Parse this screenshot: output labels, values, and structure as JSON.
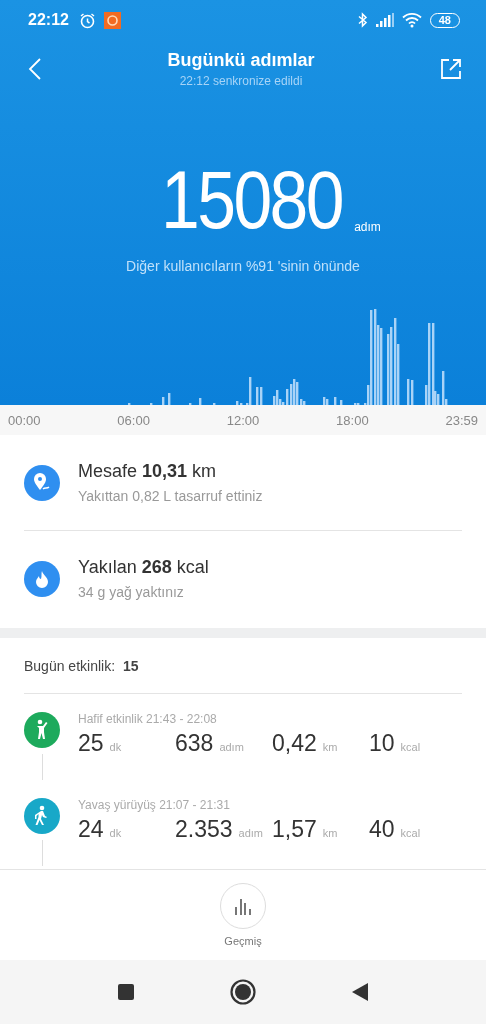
{
  "status_bar": {
    "time": "22:12",
    "battery": "48"
  },
  "header": {
    "title": "Bugünkü adımlar",
    "subtitle": "22:12 senkronize edildi"
  },
  "steps": {
    "value": "15080",
    "unit": "adım",
    "rank": "Diğer kullanıcıların %91 'sinin önünde"
  },
  "timeline": [
    "00:00",
    "06:00",
    "12:00",
    "18:00",
    "23:59"
  ],
  "metrics": [
    {
      "kind": "distance",
      "title": "Mesafe **10,31** km",
      "note": "Yakıttan 0,82 L tasarruf ettiniz"
    },
    {
      "kind": "calories",
      "title": "Yakılan **268** kcal",
      "note": "34 g yağ yaktınız"
    }
  ],
  "activities_header": {
    "label": "Bugün etkinlik:",
    "count": "15"
  },
  "activities": [
    {
      "kind": "light",
      "color": "#1daa5c",
      "title": "Hafif etkinlik 21:43 - 22:08",
      "stats": [
        {
          "value": "25",
          "unit": "dk"
        },
        {
          "value": "638",
          "unit": "adım"
        },
        {
          "value": "0,42",
          "unit": "km"
        },
        {
          "value": "10",
          "unit": "kcal"
        }
      ]
    },
    {
      "kind": "walk",
      "color": "#18a8c8",
      "title": "Yavaş yürüyüş 21:07 - 21:31",
      "stats": [
        {
          "value": "24",
          "unit": "dk"
        },
        {
          "value": "2.353",
          "unit": "adım"
        },
        {
          "value": "1,57",
          "unit": "km"
        },
        {
          "value": "40",
          "unit": "kcal"
        }
      ]
    }
  ],
  "history_button": {
    "label": "Geçmiş"
  }
}
